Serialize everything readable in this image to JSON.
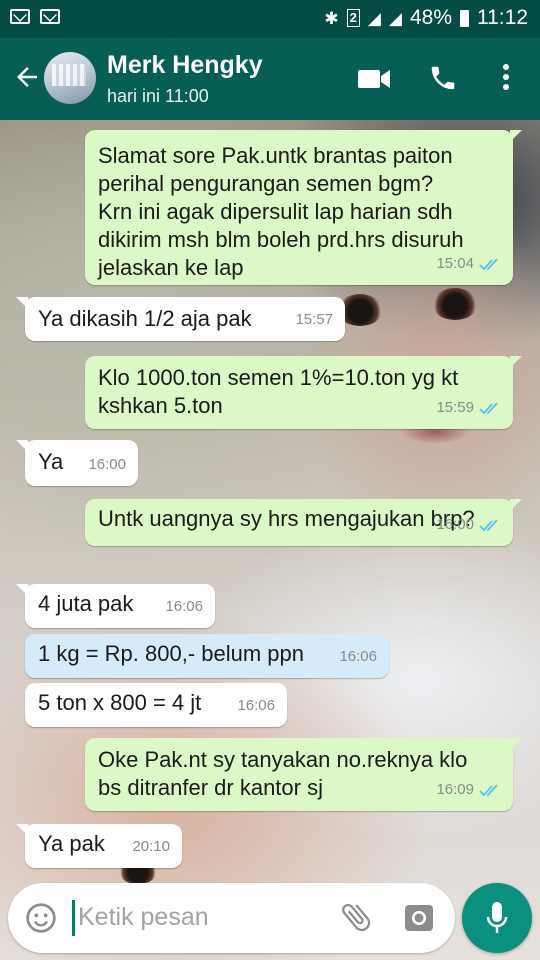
{
  "status_bar": {
    "sim_badge": "2",
    "battery": "48%",
    "time": "11:12"
  },
  "header": {
    "contact_name": "Merk Hengky",
    "last_seen": "hari ini 11:00"
  },
  "messages": [
    {
      "direction": "out",
      "text": "Slamat sore Pak.untk brantas paiton\nperihal pengurangan semen bgm?\nKrn ini agak dipersulit lap harian sdh\ndikirim msh blm boleh prd.hrs disuruh\njelaskan ke lap",
      "time": "15:04",
      "read": true
    },
    {
      "direction": "in",
      "text": "Ya dikasih 1/2 aja pak",
      "time": "15:57"
    },
    {
      "direction": "out",
      "text": "Klo 1000.ton semen 1%=10.ton yg kt\nkshkan 5.ton",
      "time": "15:59",
      "read": true
    },
    {
      "direction": "in",
      "text": "Ya",
      "time": "16:00"
    },
    {
      "direction": "out",
      "text": "Untk uangnya sy hrs mengajukan brp?",
      "time": "16:00",
      "read": true
    },
    {
      "direction": "in",
      "text": "4 juta pak",
      "time": "16:06"
    },
    {
      "direction": "in",
      "text": "1 kg = Rp. 800,- belum ppn",
      "time": "16:06",
      "highlighted": true
    },
    {
      "direction": "in",
      "text": "5 ton x 800 = 4 jt",
      "time": "16:06"
    },
    {
      "direction": "out",
      "text": "Oke Pak.nt sy tanyakan no.reknya klo\nbs ditranfer dr kantor sj",
      "time": "16:09",
      "read": true
    },
    {
      "direction": "in",
      "text": "Ya pak",
      "time": "20:10"
    }
  ],
  "composer": {
    "placeholder": "Ketik pesan"
  },
  "colors": {
    "header": "#075e54",
    "status_bar": "#054d44",
    "outgoing_bubble": "#dcf8c6",
    "incoming_bubble": "#ffffff",
    "read_ticks": "#4fc3f7",
    "mic_button": "#0b8f7e"
  }
}
